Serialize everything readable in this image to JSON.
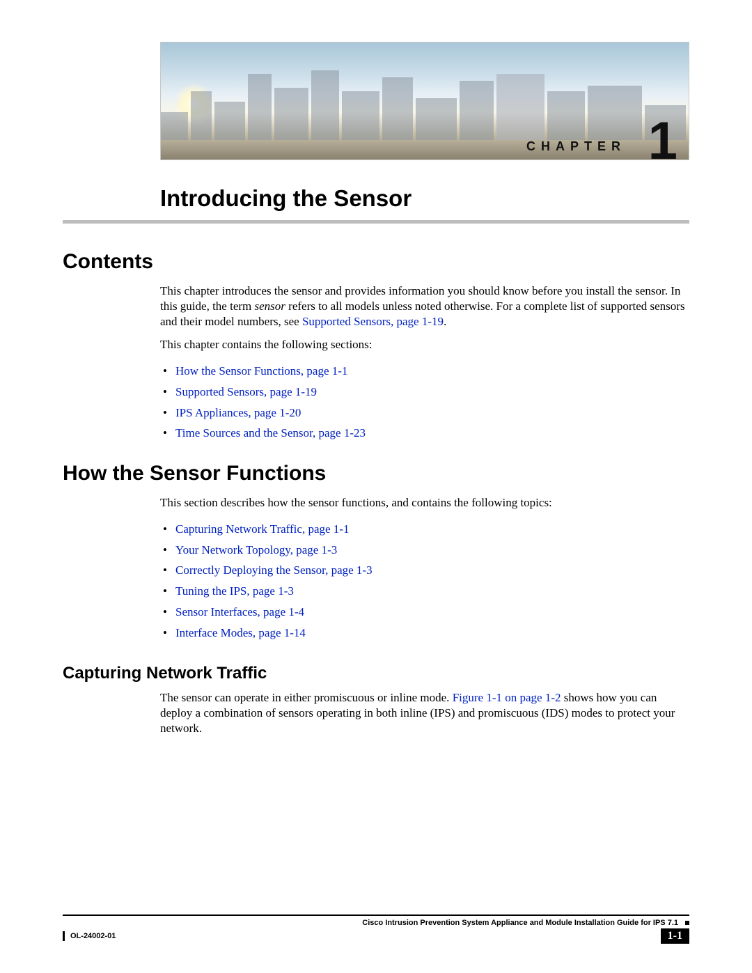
{
  "banner": {
    "chapter_label": "CHAPTER",
    "chapter_number": "1"
  },
  "chapter_title": "Introducing the Sensor",
  "contents": {
    "heading": "Contents",
    "intro_pre": "This chapter introduces the sensor and provides information you should know before you install the sensor. In this guide, the term ",
    "intro_em": "sensor",
    "intro_post": " refers to all models unless noted otherwise. For a complete list of supported sensors and their model numbers, see ",
    "intro_link": "Supported Sensors, page 1-19",
    "intro_end": ".",
    "sections_lead": "This chapter contains the following sections:",
    "items": [
      "How the Sensor Functions, page 1-1",
      "Supported Sensors, page 1-19",
      "IPS Appliances, page 1-20",
      "Time Sources and the Sensor, page 1-23"
    ]
  },
  "functions": {
    "heading": "How the Sensor Functions",
    "lead": "This section describes how the sensor functions, and contains the following topics:",
    "items": [
      "Capturing Network Traffic, page 1-1",
      "Your Network Topology, page 1-3",
      "Correctly Deploying the Sensor, page 1-3",
      "Tuning the IPS, page 1-3",
      "Sensor Interfaces, page 1-4",
      "Interface Modes, page 1-14"
    ]
  },
  "capturing": {
    "heading": "Capturing Network Traffic",
    "para_pre": "The sensor can operate in either promiscuous or inline mode. ",
    "para_link": "Figure 1-1 on page 1-2",
    "para_post": " shows how you can deploy a combination of sensors operating in both inline (IPS) and promiscuous (IDS) modes to protect your network."
  },
  "footer": {
    "guide": "Cisco Intrusion Prevention System Appliance and Module Installation Guide for IPS 7.1",
    "page": "1-1",
    "doc": "OL-24002-01"
  }
}
